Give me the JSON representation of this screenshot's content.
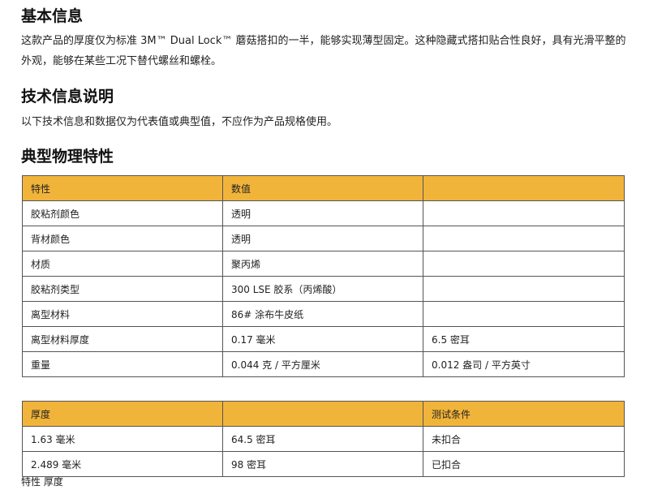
{
  "basic": {
    "heading": "基本信息",
    "text": "这款产品的厚度仅为标准 3M™ Dual Lock™ 蘑菇搭扣的一半，能够实现薄型固定。这种隐藏式搭扣贴合性良好，具有光滑平整的外观，能够在某些工况下替代螺丝和螺栓。"
  },
  "tech": {
    "heading": "技术信息说明",
    "text": "以下技术信息和数据仅为代表值或典型值，不应作为产品规格使用。"
  },
  "props": {
    "heading": "典型物理特性",
    "headers": [
      "特性",
      "数值",
      ""
    ],
    "rows": [
      [
        "胶粘剂颜色",
        "透明",
        ""
      ],
      [
        "背材颜色",
        "透明",
        ""
      ],
      [
        "材质",
        "聚丙烯",
        ""
      ],
      [
        "胶粘剂类型",
        "300 LSE 胶系（丙烯酸）",
        ""
      ],
      [
        "离型材料",
        "86# 涂布牛皮纸",
        ""
      ],
      [
        "离型材料厚度",
        "0.17 毫米",
        "6.5 密耳"
      ],
      [
        "重量",
        "0.044 克 / 平方厘米",
        "0.012 盎司 / 平方英寸"
      ]
    ]
  },
  "thickness": {
    "headers": [
      "厚度",
      "",
      "测试条件"
    ],
    "rows": [
      [
        "1.63 毫米",
        "64.5 密耳",
        "未扣合"
      ],
      [
        "2.489 毫米",
        "98 密耳",
        "已扣合"
      ]
    ]
  },
  "next": {
    "text": "特性    厚度"
  }
}
